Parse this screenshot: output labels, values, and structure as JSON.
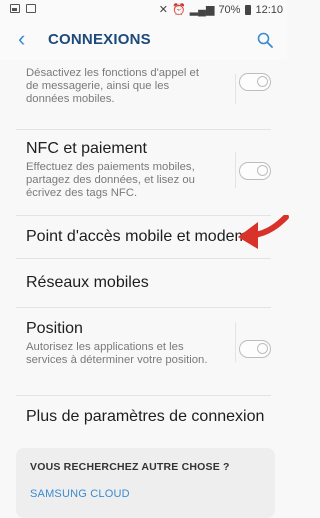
{
  "status_bar": {
    "left_icons": [
      "gallery-icon",
      "screenshot-icon"
    ],
    "right_glyphs": [
      "mute-icon",
      "alarm-icon",
      "4g-icon",
      "signal-icon"
    ],
    "battery": "70%",
    "time": "12:10"
  },
  "header": {
    "back_icon": "chevron-left-icon",
    "title": "CONNEXIONS",
    "search_icon": "search-icon"
  },
  "items": [
    {
      "description": "Désactivez les fonctions d'appel et de messagerie, ainsi que les données mobiles.",
      "toggle": false
    },
    {
      "title": "NFC et paiement",
      "description": "Effectuez des paiements mobiles, partagez des données, et lisez ou écrivez des tags NFC.",
      "toggle": false
    },
    {
      "title": "Point d'accès mobile et modem"
    },
    {
      "title": "Réseaux mobiles"
    },
    {
      "title": "Position",
      "description": "Autorisez les applications et les services à déterminer votre position.",
      "toggle": false
    },
    {
      "title": "Plus de paramètres de connexion"
    }
  ],
  "suggestion_card": {
    "heading": "VOUS RECHERCHEZ AUTRE CHOSE ?",
    "link": "SAMSUNG CLOUD"
  },
  "colors": {
    "accent": "#3b8bd0",
    "title": "#1d4a7a",
    "arrow": "#d9322a"
  }
}
